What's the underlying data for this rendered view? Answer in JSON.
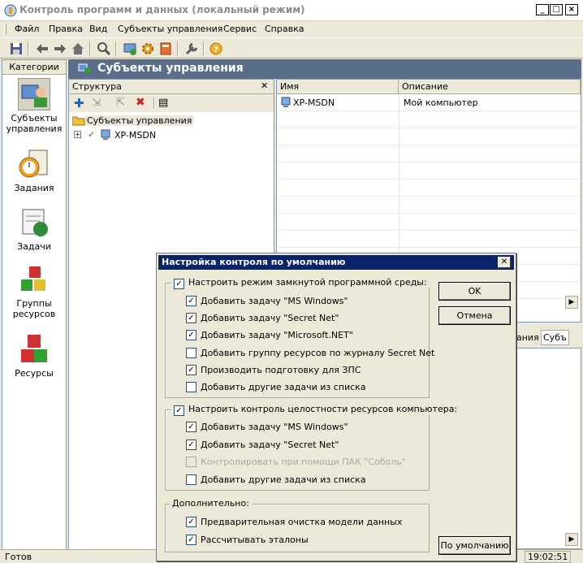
{
  "window": {
    "title": "Контроль программ и данных (локальный режим)",
    "min": "_",
    "max": "□",
    "close": "×"
  },
  "menu": [
    "Файл",
    "Правка",
    "Вид",
    "Субъекты управления",
    "Сервис",
    "Справка"
  ],
  "categories": {
    "header": "Категории",
    "items": [
      "Субъекты управления",
      "Задания",
      "Задачи",
      "Группы ресурсов",
      "Ресурсы"
    ]
  },
  "panel_title": "Субъекты управления",
  "structure": {
    "title": "Структура",
    "root": "Субъекты управления",
    "child": "XP-MSDN",
    "expand": "+"
  },
  "list": {
    "columns": [
      "Имя",
      "Описание"
    ],
    "rows": [
      {
        "name": "XP-MSDN",
        "desc": "Мой компьютер"
      }
    ]
  },
  "hidden_tabs": {
    "tab1": "ания",
    "tab2": "Субъ"
  },
  "status": {
    "text": "Готов",
    "time": "19:02:51"
  },
  "dialog": {
    "title": "Настройка контроля по умолчанию",
    "group1": {
      "label": "Настроить режим замкнутой программной среды:",
      "checked": true,
      "items": [
        {
          "label": "Добавить задачу \"MS Windows\"",
          "checked": true,
          "disabled": false
        },
        {
          "label": "Добавить задачу \"Secret Net\"",
          "checked": true,
          "disabled": false
        },
        {
          "label": "Добавить задачу \"Microsoft.NET\"",
          "checked": true,
          "disabled": false
        },
        {
          "label": "Добавить группу ресурсов по журналу Secret Net",
          "checked": false,
          "disabled": false
        },
        {
          "label": "Производить подготовку для ЗПС",
          "checked": true,
          "disabled": false
        },
        {
          "label": "Добавить другие задачи из списка",
          "checked": false,
          "disabled": false
        }
      ]
    },
    "group2": {
      "label": "Настроить контроль целостности ресурсов компьютера:",
      "checked": true,
      "items": [
        {
          "label": "Добавить задачу \"MS Windows\"",
          "checked": true,
          "disabled": false
        },
        {
          "label": "Добавить задачу \"Secret Net\"",
          "checked": true,
          "disabled": false
        },
        {
          "label": "Контролировать при помощи ПАК \"Соболь\"",
          "checked": false,
          "disabled": true
        },
        {
          "label": "Добавить другие задачи из списка",
          "checked": false,
          "disabled": false
        }
      ]
    },
    "group3": {
      "label": "Дополнительно:",
      "items": [
        {
          "label": "Предварительная очистка модели данных",
          "checked": true,
          "disabled": false
        },
        {
          "label": "Рассчитывать эталоны",
          "checked": true,
          "disabled": false
        }
      ]
    },
    "buttons": {
      "ok": "OK",
      "cancel": "Отмена",
      "defaults": "По умолчанию"
    }
  },
  "colors": {
    "dialog_title": "#0a246a",
    "panel_header": "#5a6e8c",
    "selection": "#e9e6dc"
  }
}
